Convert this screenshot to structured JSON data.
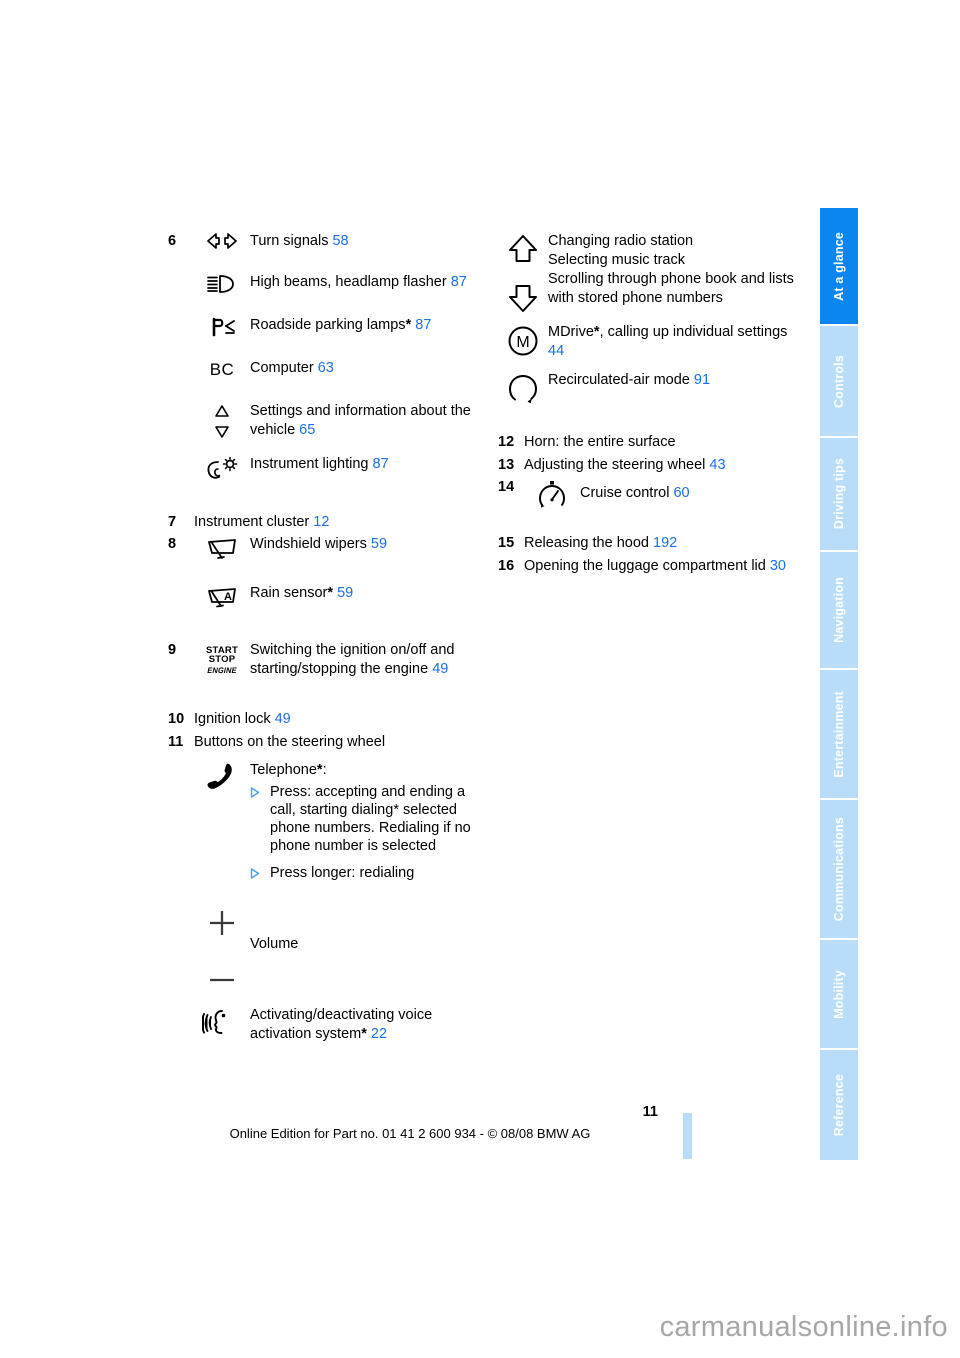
{
  "page": {
    "number": "11",
    "footer_text": "Online Edition for Part no. 01 41 2 600 934 - © 08/08 BMW AG",
    "watermark": "carmanualsonline.info",
    "accent_blue": "#1a6fe8",
    "tab_active_color": "#0b86f0",
    "tab_inactive_color": "#b9dcf8"
  },
  "tabs": [
    {
      "label": "At a glance",
      "active": true
    },
    {
      "label": "Controls",
      "active": false
    },
    {
      "label": "Driving tips",
      "active": false
    },
    {
      "label": "Navigation",
      "active": false
    },
    {
      "label": "Entertainment",
      "active": false
    },
    {
      "label": "Communications",
      "active": false
    },
    {
      "label": "Mobility",
      "active": false
    },
    {
      "label": "Reference",
      "active": false
    }
  ],
  "left_column": {
    "item6": {
      "number": "6",
      "entries": [
        {
          "icon": "turn-signals-icon",
          "text": "Turn signals",
          "page": "58",
          "asterisk": false
        },
        {
          "icon": "high-beam-icon",
          "text": "High beams, headlamp flasher",
          "page": "87",
          "asterisk": false
        },
        {
          "icon": "roadside-parking-lamp-icon",
          "text": "Roadside parking lamps",
          "page": "87",
          "asterisk": true
        },
        {
          "icon": "bc-computer-icon",
          "text": "Computer",
          "page": "63",
          "asterisk": false
        },
        {
          "icon": "up-down-triangle-icon",
          "text": "Settings and information about the vehicle",
          "page": "65",
          "asterisk": false
        },
        {
          "icon": "instrument-lighting-icon",
          "text": "Instrument lighting",
          "page": "87",
          "asterisk": false
        }
      ]
    },
    "item7": {
      "number": "7",
      "text": "Instrument cluster",
      "page": "12"
    },
    "item8": {
      "number": "8",
      "entries": [
        {
          "icon": "windshield-wiper-icon",
          "text": "Windshield wipers",
          "page": "59",
          "asterisk": false
        },
        {
          "icon": "rain-sensor-icon",
          "text": "Rain sensor",
          "page": "59",
          "asterisk": true
        }
      ]
    },
    "item9": {
      "number": "9",
      "icon": "start-stop-engine-icon",
      "icon_lines": [
        "START",
        "STOP",
        "ENGINE"
      ],
      "text": "Switching the ignition on/off and starting/stopping the engine",
      "page": "49"
    },
    "item10": {
      "number": "10",
      "text": "Ignition lock",
      "page": "49"
    },
    "item11": {
      "number": "11",
      "text": "Buttons on the steering wheel",
      "telephone": {
        "icon": "telephone-handset-icon",
        "label": "Telephone",
        "asterisk": true,
        "label_suffix": ":",
        "bullets": [
          "Press: accepting and ending a call, starting dialing* selected phone numbers. Redialing if no phone number is selected",
          "Press longer: redialing"
        ]
      },
      "volume": {
        "icon": "plus-minus-volume-icon",
        "label": "Volume"
      },
      "voice": {
        "icon": "voice-activation-icon",
        "text": "Activating/deactivating voice activation system",
        "asterisk": true,
        "page": "22"
      }
    }
  },
  "right_column": {
    "arrows": {
      "icon_up": "arrow-up-icon",
      "icon_down": "arrow-down-icon",
      "lines": [
        "Changing radio station",
        "Selecting music track",
        "Scrolling through phone book and lists with stored phone numbers"
      ]
    },
    "mdrive": {
      "icon": "mdrive-m-icon",
      "text": "MDrive",
      "asterisk": true,
      "text_rest": ", calling up individual settings",
      "page": "44"
    },
    "recirculation": {
      "icon": "recirculated-air-icon",
      "text": "Recirculated-air mode",
      "page": "91"
    },
    "item12": {
      "number": "12",
      "text": "Horn: the entire surface",
      "page": ""
    },
    "item13": {
      "number": "13",
      "text": "Adjusting the steering wheel",
      "page": "43"
    },
    "item14": {
      "number": "14",
      "icon": "cruise-control-icon",
      "text": "Cruise control",
      "page": "60"
    },
    "item15": {
      "number": "15",
      "text": "Releasing the hood",
      "page": "192"
    },
    "item16": {
      "number": "16",
      "text": "Opening the luggage compartment lid",
      "page": "30"
    }
  }
}
